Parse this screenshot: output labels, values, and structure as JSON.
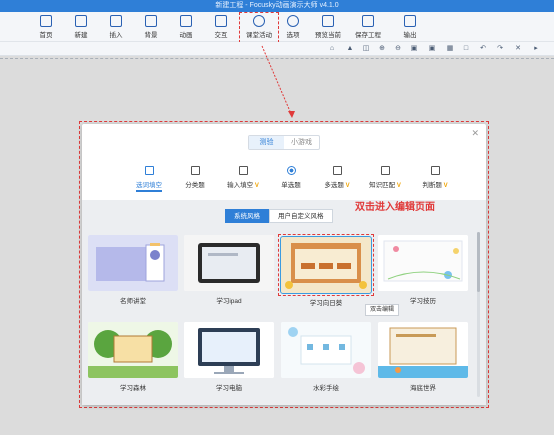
{
  "window": {
    "title": "新建工程 - Focusky动画演示大师  v4.1.0"
  },
  "toolbar": {
    "items": [
      {
        "label": "首页",
        "icon": "home-icon"
      },
      {
        "label": "新建",
        "icon": "new-doc-icon"
      },
      {
        "label": "插入",
        "icon": "insert-icon"
      },
      {
        "label": "背景",
        "icon": "background-icon"
      },
      {
        "label": "动画",
        "icon": "animation-icon"
      },
      {
        "label": "交互",
        "icon": "interact-icon"
      },
      {
        "label": "课堂活动",
        "icon": "classroom-activity-icon"
      },
      {
        "label": "选项",
        "icon": "gear-icon"
      },
      {
        "label": "预览当前",
        "icon": "preview-icon"
      },
      {
        "label": "保存工程",
        "icon": "save-icon"
      },
      {
        "label": "输出",
        "icon": "export-icon"
      }
    ]
  },
  "dialog": {
    "mode_tabs": [
      "测验",
      "小游戏"
    ],
    "active_mode": "测验",
    "question_types": [
      {
        "label": "选词填空",
        "vip": false
      },
      {
        "label": "分类题",
        "vip": false
      },
      {
        "label": "输入填空",
        "vip": true
      },
      {
        "label": "单选题",
        "vip": false
      },
      {
        "label": "多选题",
        "vip": true
      },
      {
        "label": "知识匹配",
        "vip": true
      },
      {
        "label": "判断题",
        "vip": true
      }
    ],
    "vip_mark": "V",
    "style_tabs": [
      "系统风格",
      "用户自定义风格"
    ],
    "annotation": "双击进入编辑页面",
    "tooltip": "双击编辑",
    "templates": [
      {
        "name": "名师讲堂"
      },
      {
        "name": "学习ipad"
      },
      {
        "name": "学习向日葵"
      },
      {
        "name": "学习技历"
      },
      {
        "name": "学习森林"
      },
      {
        "name": "学习电脑"
      },
      {
        "name": "水彩手绘"
      },
      {
        "name": "海底世界"
      }
    ]
  },
  "colors": {
    "accent": "#2f7fd7",
    "annotation": "#e03a3a",
    "vip": "#f0a300"
  }
}
